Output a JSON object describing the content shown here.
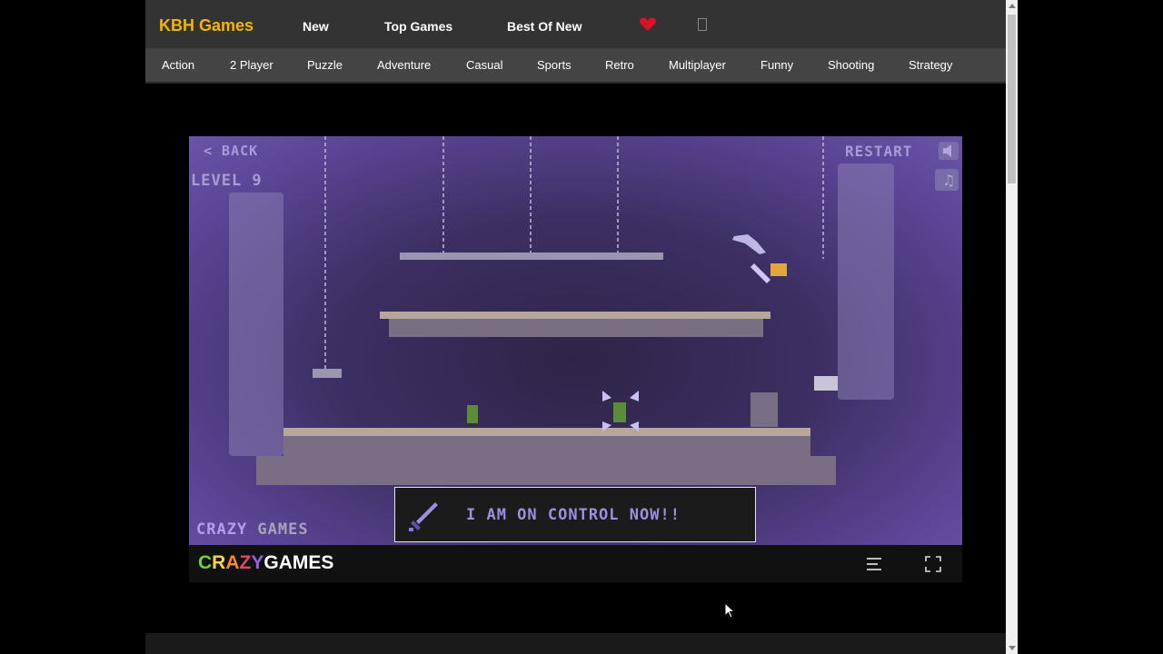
{
  "brand": "KBH Games",
  "nav": [
    "New",
    "Top Games",
    "Best Of New"
  ],
  "categories": [
    "Action",
    "2 Player",
    "Puzzle",
    "Adventure",
    "Casual",
    "Sports",
    "Retro",
    "Multiplayer",
    "Funny",
    "Shooting",
    "Strategy"
  ],
  "game": {
    "back_label": "< BACK",
    "level_label": "LEVEL 9",
    "restart_label": "RESTART",
    "toast_text": "I AM ON CONTROL NOW!!",
    "watermark": [
      "CRAZY",
      " GAMES"
    ]
  },
  "gamebar": {
    "logo_letters": [
      "C",
      "R",
      "A",
      "Z",
      "Y"
    ],
    "logo_rest": "GAMES"
  },
  "colors": {
    "brand": "#f5b400",
    "heart": "#e0102a",
    "logo_letters": [
      "#6fd13a",
      "#f5d63d",
      "#f58a2b",
      "#e8436d",
      "#9a5ee6"
    ]
  },
  "icons": {
    "favorites": "heart-icon",
    "bookmark": "bookmark-icon",
    "game_menu": "hamburger-menu-icon",
    "fullscreen": "fullscreen-icon"
  }
}
